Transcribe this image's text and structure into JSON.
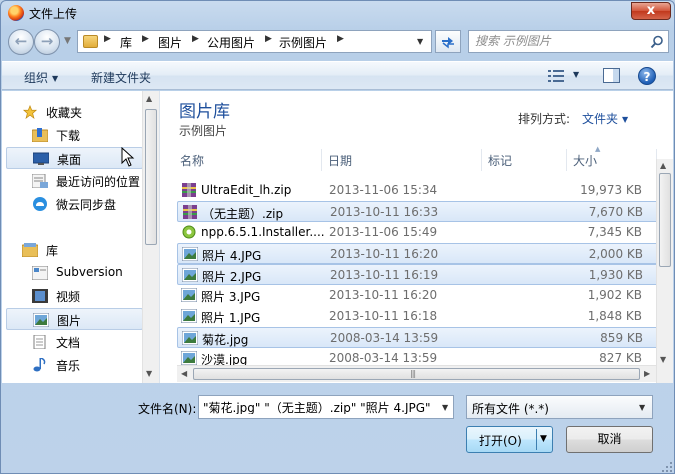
{
  "window": {
    "title": "文件上传",
    "close_glyph": "x"
  },
  "address": {
    "segments": [
      "库",
      "图片",
      "公用图片",
      "示例图片"
    ]
  },
  "search": {
    "placeholder": "搜索 示例图片"
  },
  "toolbar": {
    "organize_label": "组织",
    "new_folder_label": "新建文件夹"
  },
  "sidebar": {
    "favorites_label": "收藏夹",
    "favorites": [
      {
        "label": "下载",
        "icon": "download-folder-icon"
      },
      {
        "label": "桌面",
        "icon": "desktop-icon",
        "selected": true
      },
      {
        "label": "最近访问的位置",
        "icon": "recent-places-icon"
      },
      {
        "label": "微云同步盘",
        "icon": "cloud-sync-icon"
      }
    ],
    "libraries_label": "库",
    "libraries": [
      {
        "label": "Subversion",
        "icon": "subversion-icon"
      },
      {
        "label": "视频",
        "icon": "video-icon"
      },
      {
        "label": "图片",
        "icon": "pictures-icon",
        "selected": true
      },
      {
        "label": "文档",
        "icon": "documents-icon"
      },
      {
        "label": "音乐",
        "icon": "music-icon"
      }
    ]
  },
  "library": {
    "title": "图片库",
    "subtitle": "示例图片",
    "arrange_label": "排列方式:",
    "arrange_value": "文件夹"
  },
  "columns": {
    "name": "名称",
    "date": "日期",
    "tags": "标记",
    "size": "大小"
  },
  "files": [
    {
      "name": "UltraEdit_lh.zip",
      "date": "2013-11-06 15:34",
      "size": "19,973 KB",
      "icon": "archive-icon",
      "selected": false
    },
    {
      "name": "（无主题）.zip",
      "date": "2013-10-11 16:33",
      "size": "7,670 KB",
      "icon": "archive-icon",
      "selected": true
    },
    {
      "name": "npp.6.5.1.Installer....",
      "date": "2013-11-06 15:49",
      "size": "7,345 KB",
      "icon": "installer-icon",
      "selected": false
    },
    {
      "name": "照片 4.JPG",
      "date": "2013-10-11 16:20",
      "size": "2,000 KB",
      "icon": "image-file-icon",
      "selected": true
    },
    {
      "name": "照片 2.JPG",
      "date": "2013-10-11 16:19",
      "size": "1,930 KB",
      "icon": "image-file-icon",
      "selected": true
    },
    {
      "name": "照片 3.JPG",
      "date": "2013-10-11 16:20",
      "size": "1,902 KB",
      "icon": "image-file-icon",
      "selected": false
    },
    {
      "name": "照片 1.JPG",
      "date": "2013-10-11 16:18",
      "size": "1,848 KB",
      "icon": "image-file-icon",
      "selected": false
    },
    {
      "name": "菊花.jpg",
      "date": "2008-03-14 13:59",
      "size": "859 KB",
      "icon": "image-file-icon",
      "selected": true
    },
    {
      "name": "沙漠.jpg",
      "date": "2008-03-14 13:59",
      "size": "827 KB",
      "icon": "image-file-icon",
      "selected": false
    }
  ],
  "bottom": {
    "filename_label": "文件名(N):",
    "filename_value": "\"菊花.jpg\" \"（无主题）.zip\" \"照片 4.JPG\" \"",
    "filetype_value": "所有文件 (*.*)",
    "open_label": "打开(O)",
    "cancel_label": "取消"
  }
}
